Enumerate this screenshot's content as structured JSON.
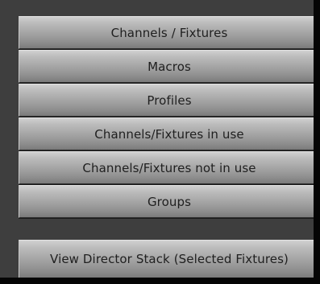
{
  "menu": {
    "items": [
      {
        "label": "Channels / Fixtures"
      },
      {
        "label": "Macros"
      },
      {
        "label": "Profiles"
      },
      {
        "label": "Channels/Fixtures in use"
      },
      {
        "label": "Channels/Fixtures not in use"
      },
      {
        "label": "Groups"
      }
    ],
    "director_stack_label": "View Director Stack (Selected Fixtures)"
  },
  "colors": {
    "panel_background": "#3e3e3e",
    "button_gradient_top": "#d0d0d0",
    "button_gradient_bottom": "#7a7a7a",
    "button_text": "#202020"
  }
}
